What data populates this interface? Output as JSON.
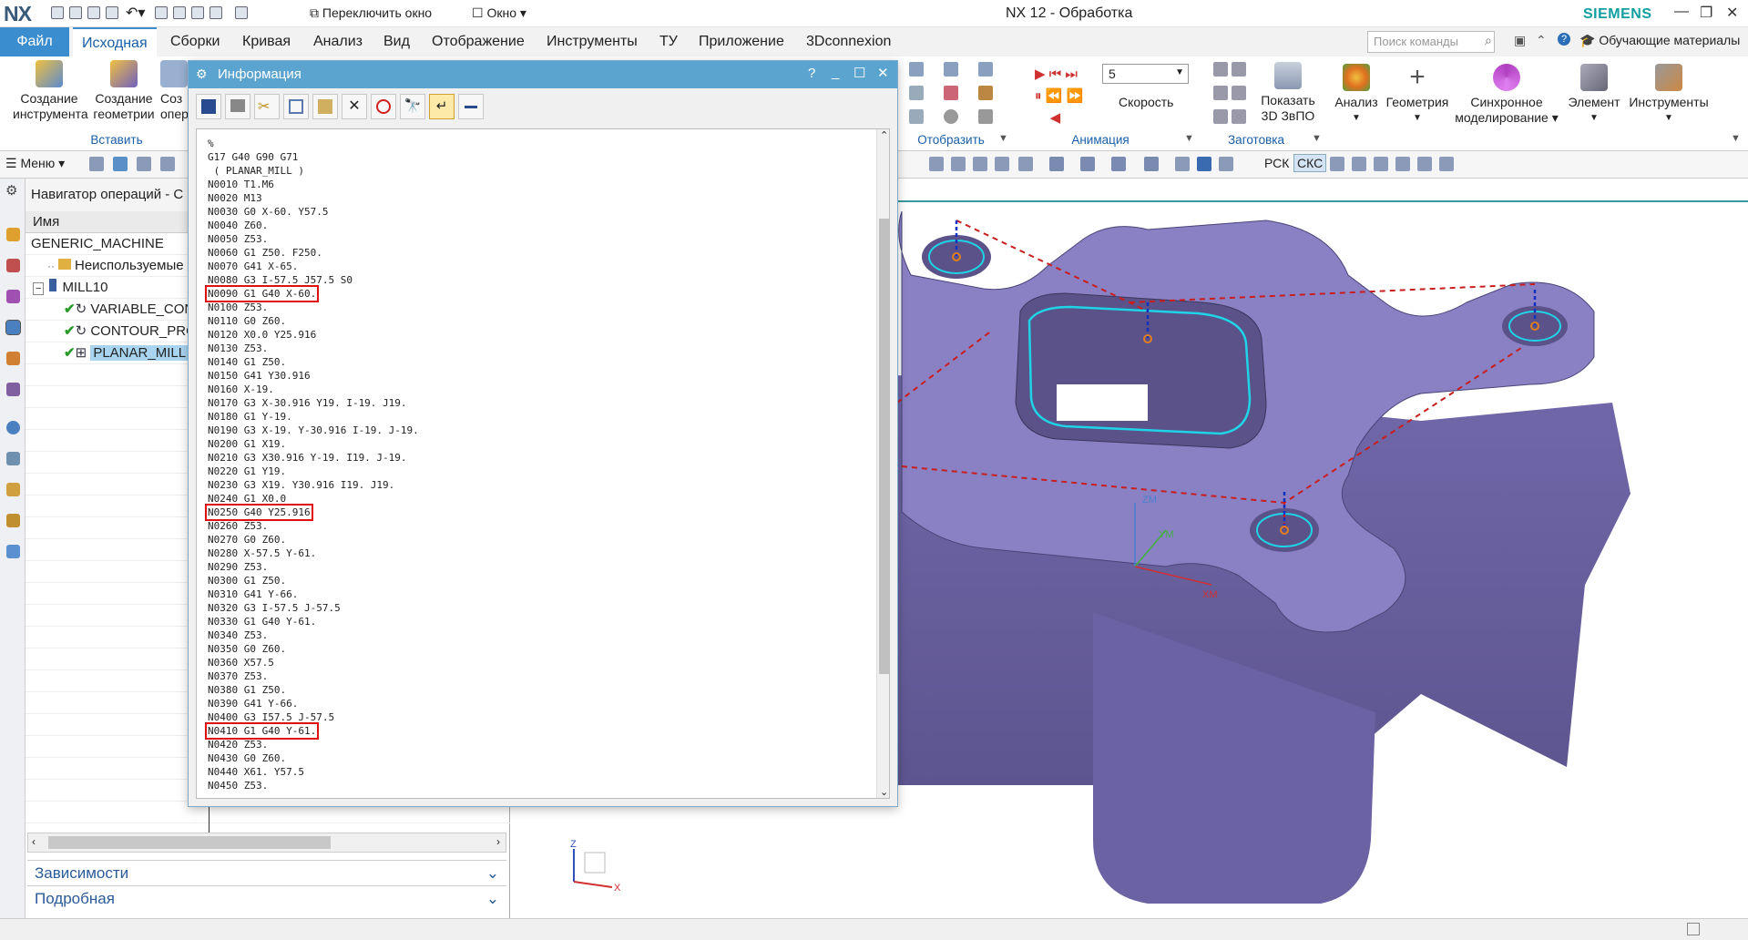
{
  "app": {
    "logo": "NX",
    "window_title": "NX 12 - Обработка",
    "brand": "SIEMENS",
    "switch_window": "Переключить окно",
    "window_menu": "Окно",
    "search_placeholder": "Поиск команды",
    "learning": "Обучающие материалы",
    "accent": "#3a8dcf",
    "brand_color": "#109ea0"
  },
  "menu": {
    "file": "Файл",
    "tabs": [
      "Исходная",
      "Сборки",
      "Кривая",
      "Анализ",
      "Вид",
      "Отображение",
      "Инструменты",
      "ТУ",
      "Приложение",
      "3Dconnexion"
    ]
  },
  "ribbon": {
    "create_tool": [
      "Создание",
      "инструмента"
    ],
    "create_geometry": [
      "Создание",
      "геометрии"
    ],
    "create_op": [
      "Соз",
      "опер"
    ],
    "insert_group": "Вставить",
    "display_group": "Отобразить",
    "animation_group": "Анимация",
    "speed_value": "5",
    "speed_label": "Скорость",
    "show_3d": [
      "Показать",
      "3D ЗвПО"
    ],
    "blank_group": "Заготовка",
    "analysis": "Анализ",
    "geometry": "Геометрия",
    "sync_modeling": [
      "Синхронное",
      "моделирование"
    ],
    "element": "Элемент",
    "tools": "Инструменты"
  },
  "toolbar2": {
    "menu": "Меню",
    "rcs": "РСК",
    "wcs": "СКС"
  },
  "navigator": {
    "title": "Навигатор операций - С",
    "column_name": "Имя",
    "rows": [
      {
        "label": "GENERIC_MACHINE",
        "indent": 0
      },
      {
        "label": "Неиспользуемые эл",
        "indent": 1
      },
      {
        "label": "MILL10",
        "indent": 1
      },
      {
        "label": "VARIABLE_CON",
        "indent": 2
      },
      {
        "label": "CONTOUR_PRO",
        "indent": 2
      },
      {
        "label": "PLANAR_MILL",
        "indent": 2
      }
    ],
    "dependencies": "Зависимости",
    "details": "Подробная"
  },
  "info_dialog": {
    "title": "Информация",
    "help": "?",
    "code_lines": [
      "%",
      "G17 G40 G90 G71",
      " ( PLANAR_MILL )",
      "N0010 T1.M6",
      "N0020 M13",
      "N0030 G0 X-60. Y57.5",
      "N0040 Z60.",
      "N0050 Z53.",
      "N0060 G1 Z50. F250.",
      "N0070 G41 X-65.",
      "N0080 G3 I-57.5 J57.5 S0",
      "N0090 G1 G40 X-60.",
      "N0100 Z53.",
      "N0110 G0 Z60.",
      "N0120 X0.0 Y25.916",
      "N0130 Z53.",
      "N0140 G1 Z50.",
      "N0150 G41 Y30.916",
      "N0160 X-19.",
      "N0170 G3 X-30.916 Y19. I-19. J19.",
      "N0180 G1 Y-19.",
      "N0190 G3 X-19. Y-30.916 I-19. J-19.",
      "N0200 G1 X19.",
      "N0210 G3 X30.916 Y-19. I19. J-19.",
      "N0220 G1 Y19.",
      "N0230 G3 X19. Y30.916 I19. J19.",
      "N0240 G1 X0.0",
      "N0250 G40 Y25.916",
      "N0260 Z53.",
      "N0270 G0 Z60.",
      "N0280 X-57.5 Y-61.",
      "N0290 Z53.",
      "N0300 G1 Z50.",
      "N0310 G41 Y-66.",
      "N0320 G3 I-57.5 J-57.5",
      "N0330 G1 G40 Y-61.",
      "N0340 Z53.",
      "N0350 G0 Z60.",
      "N0360 X57.5",
      "N0370 Z53.",
      "N0380 G1 Z50.",
      "N0390 G41 Y-66.",
      "N0400 G3 I57.5 J-57.5",
      "N0410 G1 G40 Y-61.",
      "N0420 Z53.",
      "N0430 G0 Z60.",
      "N0440 X61. Y57.5",
      "N0450 Z53."
    ],
    "highlighted": [
      11,
      27,
      43
    ],
    "highlight_color": "#e01010"
  },
  "viewport": {
    "axis_zm": "ZM",
    "axis_ym": "YM",
    "axis_xm": "XM",
    "triad_z": "Z",
    "triad_x": "X",
    "part_color": "#7d72b4",
    "path_color": "#20d4e8",
    "rapid_color": "#c81e1e"
  }
}
